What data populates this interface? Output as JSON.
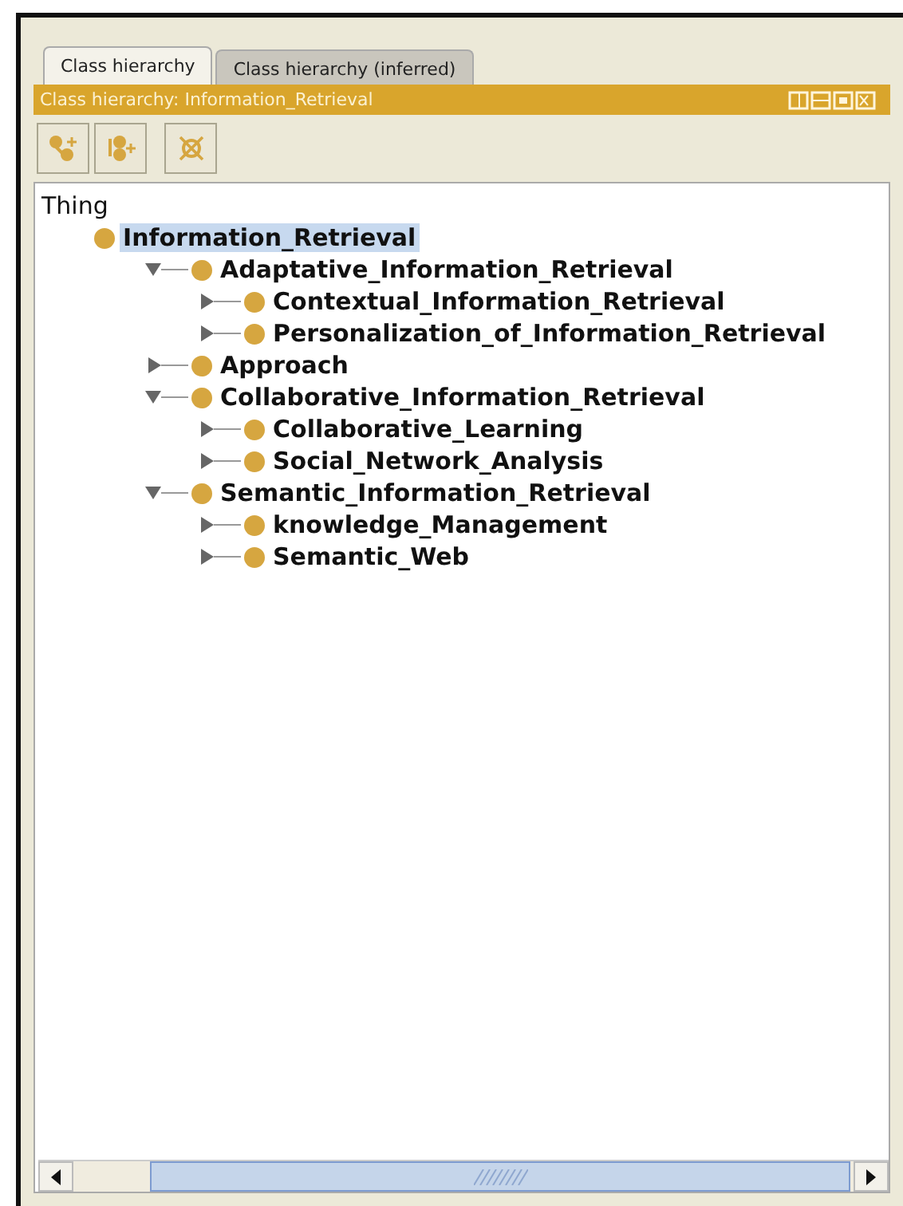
{
  "tabs": [
    {
      "label": "Class hierarchy",
      "selected": true
    },
    {
      "label": "Class hierarchy (inferred)",
      "selected": false
    }
  ],
  "view_title": "Class hierarchy: Information_Retrieval",
  "toolbar": [
    {
      "kind": "add-subclass"
    },
    {
      "kind": "add-sibling"
    },
    {
      "kind": "delete"
    }
  ],
  "tree": {
    "label": "Thing",
    "children": [
      {
        "label": "Information_Retrieval",
        "selected": true,
        "children": [
          {
            "label": "Adaptative_Information_Retrieval",
            "expanded": true,
            "selected": false,
            "children": [
              {
                "label": "Contextual_Information_Retrieval",
                "expanded": false,
                "selected": false
              },
              {
                "label": "Personalization_of_Information_Retrieval",
                "expanded": false,
                "selected": false
              }
            ]
          },
          {
            "label": "Approach",
            "expanded": false,
            "selected": false
          },
          {
            "label": "Collaborative_Information_Retrieval",
            "expanded": true,
            "selected": false,
            "children": [
              {
                "label": "Collaborative_Learning",
                "expanded": false,
                "selected": false
              },
              {
                "label": "Social_Network_Analysis",
                "expanded": false,
                "selected": false
              }
            ]
          },
          {
            "label": "Semantic_Information_Retrieval",
            "expanded": true,
            "selected": false,
            "children": [
              {
                "label": "knowledge_Management",
                "expanded": false,
                "selected": false
              },
              {
                "label": "Semantic_Web",
                "expanded": false,
                "selected": false
              }
            ]
          }
        ]
      }
    ]
  }
}
